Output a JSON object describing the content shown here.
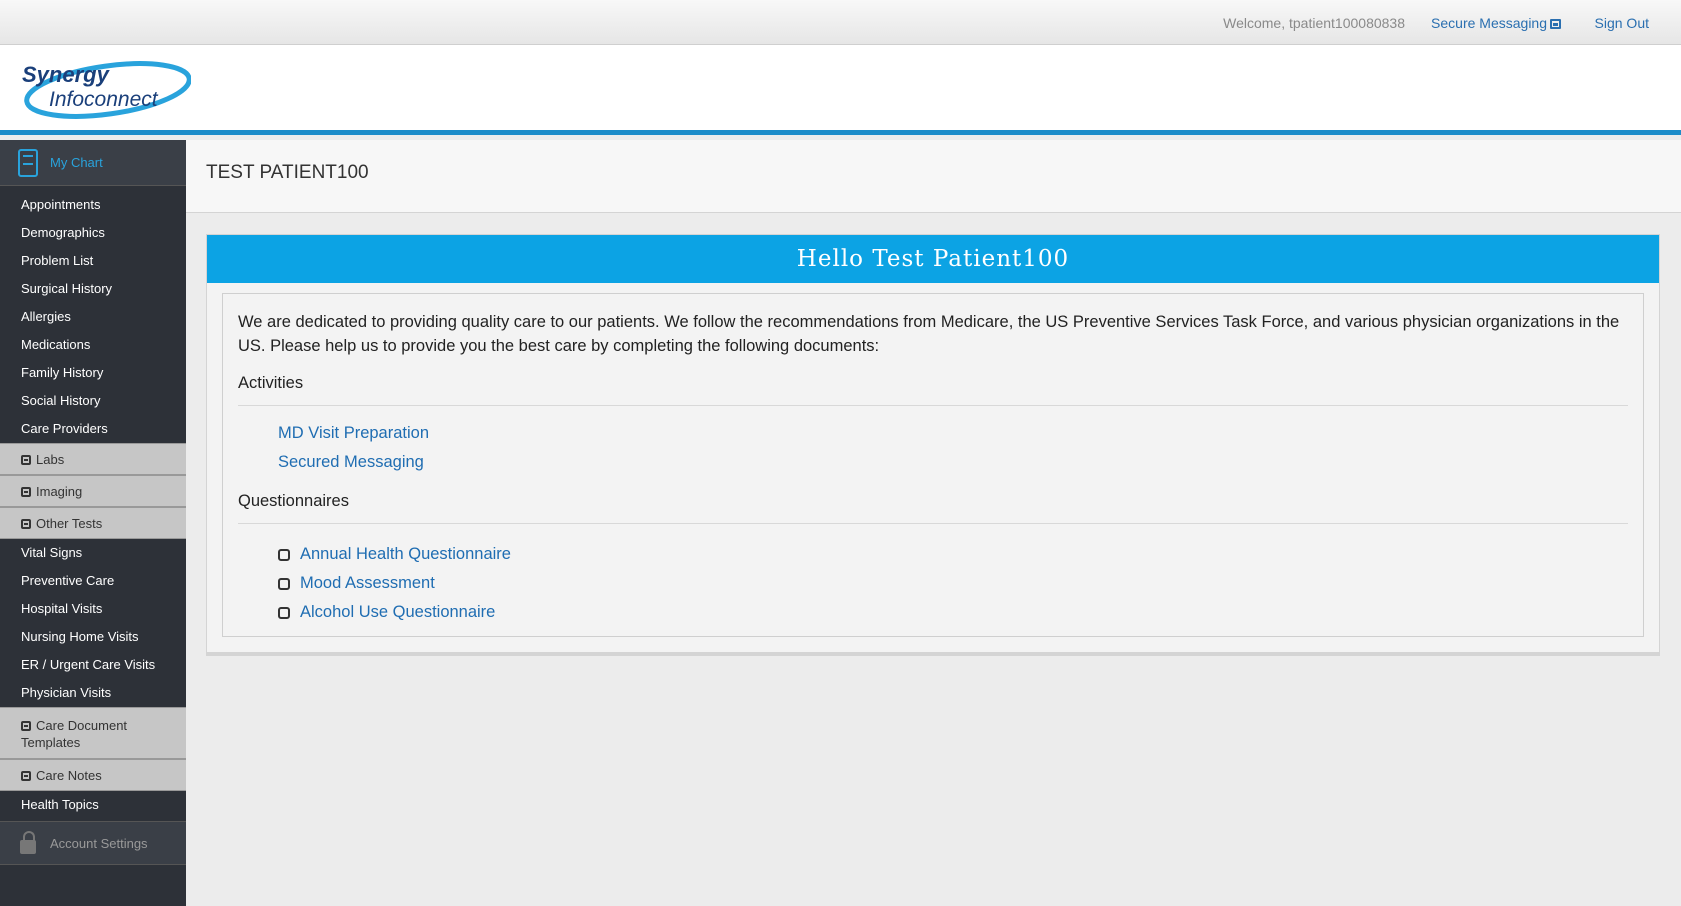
{
  "header": {
    "welcome": "Welcome, tpatient100080838",
    "secure_messaging": "Secure Messaging",
    "sign_out": "Sign Out"
  },
  "logo": {
    "line1": "Synergy",
    "line2": "Infoconnect"
  },
  "sidebar": {
    "my_chart": "My Chart",
    "items_a": [
      "Appointments",
      "Demographics",
      "Problem List",
      "Surgical History",
      "Allergies",
      "Medications",
      "Family History",
      "Social History",
      "Care Providers"
    ],
    "labs": "Labs",
    "imaging": "Imaging",
    "other_tests": "Other Tests",
    "items_b": [
      "Vital Signs",
      "Preventive Care",
      "Hospital Visits",
      "Nursing Home Visits",
      "ER / Urgent Care Visits",
      "Physician Visits"
    ],
    "care_document_templates_1": "Care Document",
    "care_document_templates_2": "Templates",
    "care_notes": "Care Notes",
    "health_topics": "Health Topics",
    "account_settings": "Account Settings"
  },
  "main": {
    "patient_name": "TEST PATIENT100",
    "greeting": "Hello Test Patient100",
    "intro": "We are dedicated to providing quality care to our patients. We follow the recommendations from Medicare, the US Preventive Services Task Force, and various physician organizations in the US. Please help us to provide you the best care by completing the following documents:",
    "activities_title": "Activities",
    "activities": [
      "MD Visit Preparation",
      "Secured Messaging"
    ],
    "questionnaires_title": "Questionnaires",
    "questionnaires": [
      "Annual Health Questionnaire",
      "Mood Assessment",
      "Alcohol Use Questionnaire"
    ]
  },
  "colors": {
    "accent": "#0ca3e4",
    "link": "#1f6db2",
    "sidebar": "#2d3138"
  }
}
